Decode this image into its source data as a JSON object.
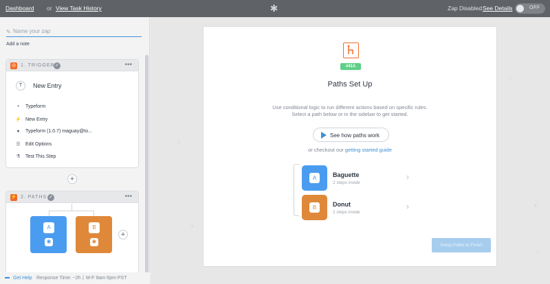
{
  "topbar": {
    "dashboard": "Dashboard",
    "or": "or",
    "history": "View Task History",
    "zap_status": "Zap Disabled",
    "see_details": "See Details",
    "toggle": "OFF"
  },
  "sidebar": {
    "name_placeholder": "Name your zap",
    "add_note": "Add a note",
    "trigger": {
      "title": "1. TRIGGER",
      "entry": "New Entry",
      "entry_icon_letter": "T",
      "details": [
        {
          "icon": "circle-icon",
          "label": "Typeform"
        },
        {
          "icon": "bolt-icon",
          "label": "New Entry"
        },
        {
          "icon": "user-icon",
          "label": "Typeform (1.0.7) maguay@to..."
        },
        {
          "icon": "list-icon",
          "label": "Edit Options"
        },
        {
          "icon": "flask-icon",
          "label": "Test This Step"
        }
      ]
    },
    "paths": {
      "title": "2. PATHS",
      "items": [
        {
          "letter": "A",
          "color": "#4a9cf0"
        },
        {
          "letter": "B",
          "color": "#e0883a"
        }
      ]
    },
    "help": {
      "label": "Get Help",
      "response": "Response Time: ~2h",
      "hours": "M-F 9am-5pm PST"
    }
  },
  "panel": {
    "tag": "#41A",
    "title": "Paths Set Up",
    "desc_line1": "Use conditional logic to run different actions based on specific rules.",
    "desc_line2": "Select a path below or in the sidebar to get started.",
    "video_button": "See how paths work",
    "checkout_prefix": "or checkout our",
    "checkout_link": "getting started guide",
    "paths": [
      {
        "letter": "A",
        "name": "Baguette",
        "steps": "2 steps inside",
        "color": "#4a9cf0"
      },
      {
        "letter": "B",
        "name": "Donut",
        "steps": "2 steps inside",
        "color": "#e0883a"
      }
    ],
    "finish_button": "Setup Paths to Finish"
  },
  "colors": {
    "accent": "#3c8fd8",
    "orange": "#f06c2a",
    "tag_green": "#5fcf88"
  }
}
